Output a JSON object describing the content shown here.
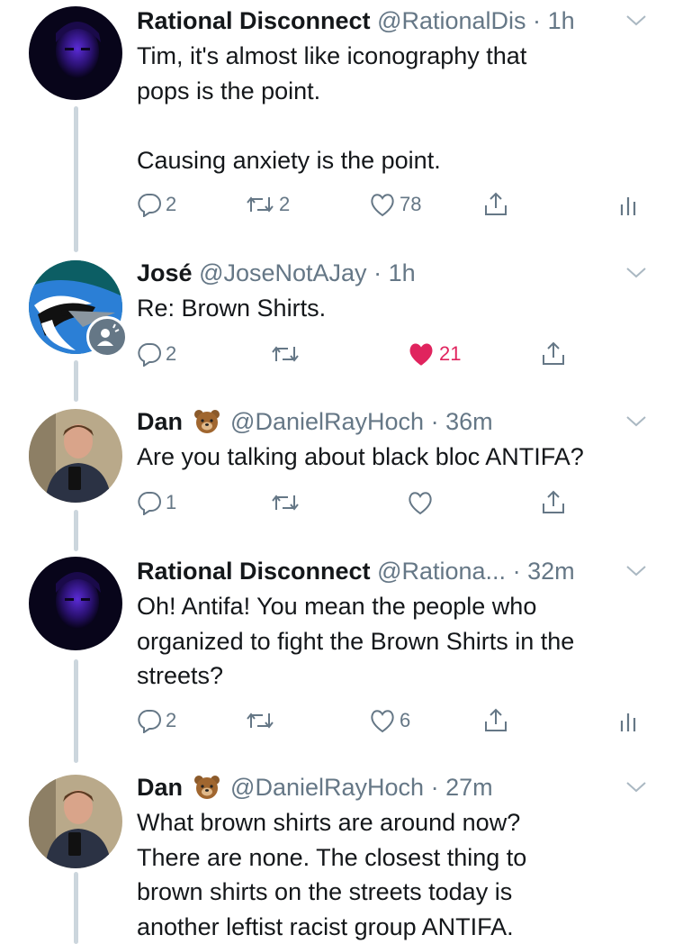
{
  "tweets": [
    {
      "name": "Rational Disconnect",
      "handle": "@RationalDis",
      "time": "1h",
      "lines": [
        "Tim, it's almost like iconography that",
        "pops is the point.",
        "",
        "Causing anxiety is the point."
      ],
      "replies": "2",
      "retweets": "2",
      "likes": "78",
      "liked": false,
      "has_analytics": true,
      "avatar": "dark-purple-portrait"
    },
    {
      "name": "José",
      "handle": "@JoseNotAJay",
      "time": "1h",
      "lines": [
        "Re: Brown Shirts."
      ],
      "replies": "2",
      "retweets": "",
      "likes": "21",
      "liked": true,
      "has_analytics": false,
      "avatar": "blue-jay-bird"
    },
    {
      "name": "Dan",
      "name_emoji": "bear-face",
      "handle": "@DanielRayHoch",
      "time": "36m",
      "lines": [
        "Are you talking about black bloc ANTIFA?"
      ],
      "replies": "1",
      "retweets": "",
      "likes": "",
      "liked": false,
      "has_analytics": false,
      "avatar": "man-selfie"
    },
    {
      "name": "Rational Disconnect",
      "handle": "@Rationa...",
      "time": "32m",
      "lines": [
        "Oh! Antifa! You mean the people who",
        "organized to fight the Brown Shirts in the",
        "streets?"
      ],
      "replies": "2",
      "retweets": "",
      "likes": "6",
      "liked": false,
      "has_analytics": true,
      "avatar": "dark-purple-portrait"
    },
    {
      "name": "Dan",
      "name_emoji": "bear-face",
      "handle": "@DanielRayHoch",
      "time": "27m",
      "lines": [
        "What brown shirts are around now?",
        "There are none. The closest thing to",
        "brown shirts on the streets today is",
        "another leftist racist group ANTIFA."
      ],
      "avatar": "man-selfie"
    }
  ],
  "separator": "·",
  "colors": {
    "text": "#14171a",
    "secondary": "#657786",
    "like": "#e0245e",
    "thread": "#ccd6dd"
  }
}
